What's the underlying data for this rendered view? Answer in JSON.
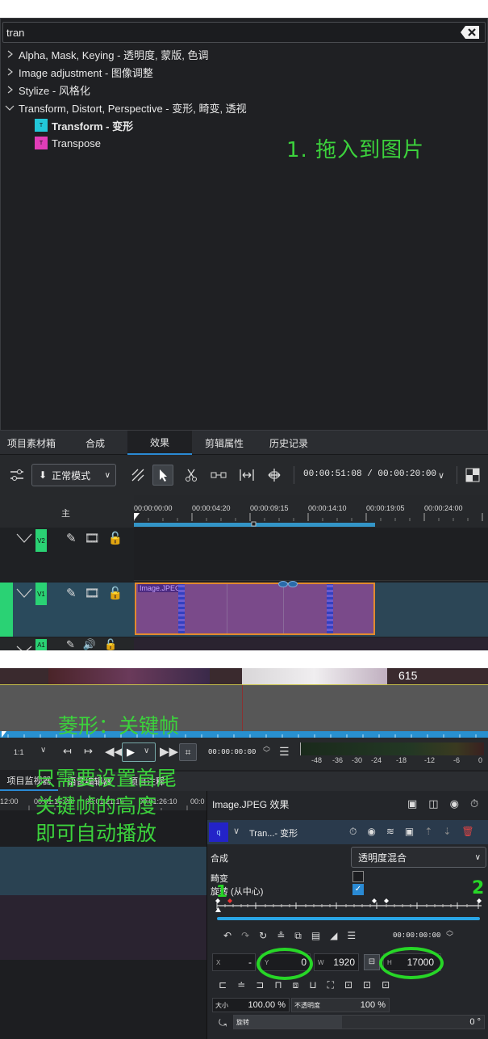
{
  "effects_panel": {
    "search": {
      "value": "tran"
    },
    "categories": [
      {
        "label": "Alpha, Mask, Keying - 透明度, 蒙版, 色调",
        "expanded": false
      },
      {
        "label": "Image adjustment - 图像调整",
        "expanded": false
      },
      {
        "label": "Stylize - 风格化",
        "expanded": false
      },
      {
        "label": "Transform, Distort, Perspective - 变形, 畸变, 透视",
        "expanded": true
      }
    ],
    "items": [
      {
        "label": "Transform - 变形",
        "badge": "T",
        "badge_color": "#22c7d9",
        "bold": true
      },
      {
        "label": "Transpose",
        "badge": "T",
        "badge_color": "#e23db8",
        "bold": false
      }
    ],
    "annotation": "1. 拖入到图片"
  },
  "bottom_tabs": [
    "项目素材箱",
    "合成",
    "效果",
    "剪辑属性",
    "历史记录"
  ],
  "bottom_tabs_active": "效果",
  "toolbar": {
    "mode_label": "正常模式",
    "timecode": "00:00:51:08 / 00:00:20:00"
  },
  "timeline": {
    "header_label": "主",
    "ruler": [
      "00:00:00:00",
      "00:00:04:20",
      "00:00:09:15",
      "00:00:14:10",
      "00:00:19:05",
      "00:00:24:00"
    ],
    "tracks": [
      {
        "tag": "V2"
      },
      {
        "tag": "V1"
      },
      {
        "tag": "A1"
      }
    ],
    "clip_label": "Image.JPEG"
  },
  "monitor": {
    "preview_number": "615",
    "zoom": "1:1",
    "timecode": "00:00:00:00",
    "meter_labels": [
      "-48",
      "-36",
      "-30",
      "-24",
      "-18",
      "-12",
      "-6",
      "0"
    ]
  },
  "monitor_tabs": [
    "项目监视器",
    "语音编辑器",
    "项目注释"
  ],
  "left_ruler": [
    "12:00",
    "00:01:16:20",
    "00:01:21:15",
    "00:01:26:10",
    "00:0"
  ],
  "annotations": {
    "diamond": "菱形：关键帧",
    "instructions": [
      "只需要设置首尾",
      "关键帧的高度",
      "即可自动播放"
    ],
    "mark1": "1",
    "mark2": "2"
  },
  "effect_stack": {
    "title": "Image.JPEG 效果",
    "effect_name": "Tran...- 变形",
    "compose_label": "合成",
    "compose_value": "透明度混合",
    "distort_label": "畸变",
    "rotate_center_label": "旋转 (从中心)",
    "kf_timecode": "00:00:00:00",
    "x_label": "X",
    "x_value": "-",
    "y_label": "Y",
    "y_value": "0",
    "w_label": "W",
    "w_value": "1920",
    "h_label": "H",
    "h_value": "17000",
    "size_label": "大小",
    "size_value": "100.00 %",
    "opacity_label": "不透明度",
    "opacity_value": "100 %",
    "rotation_label": "旋转",
    "rotation_value": "0 °",
    "distort_checked": false,
    "rotate_checked": true
  }
}
